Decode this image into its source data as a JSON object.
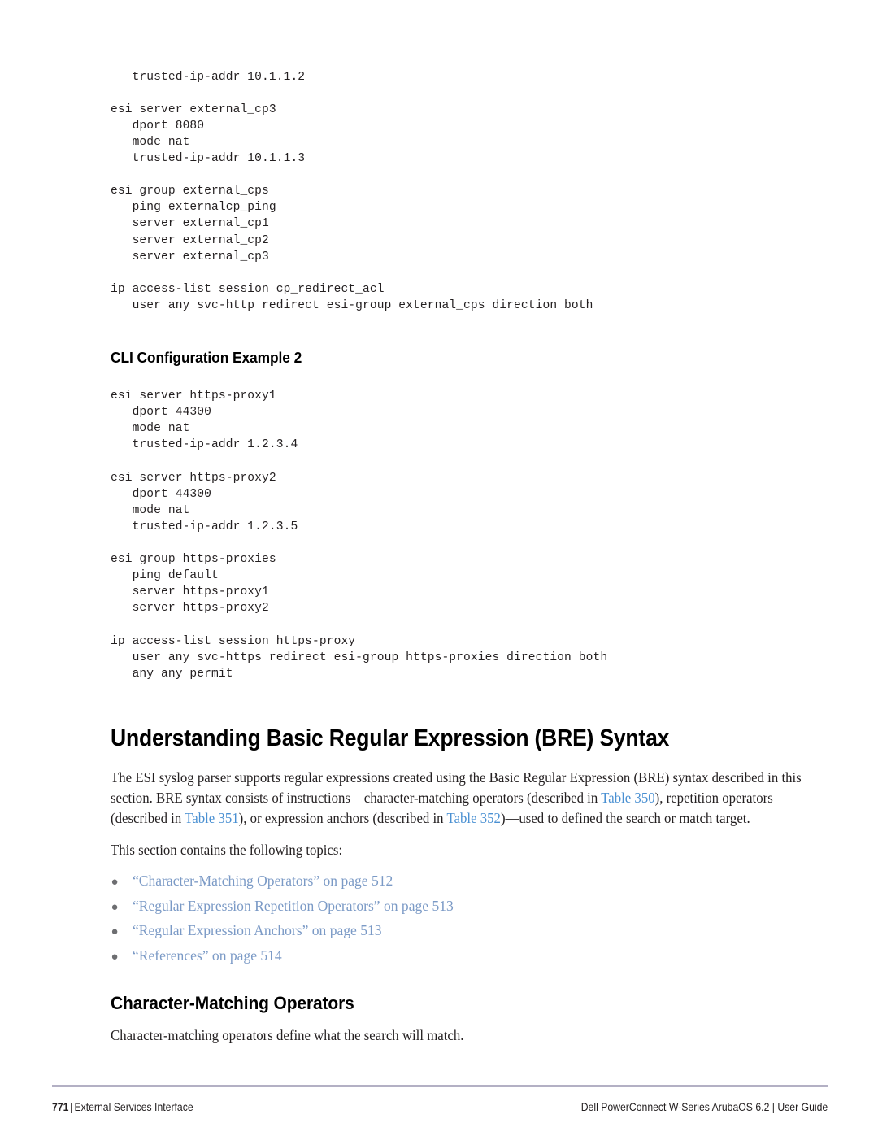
{
  "document": {
    "type": "user-guide-page",
    "page_number": "771",
    "chapter": "External Services Interface",
    "product": "Dell PowerConnect W-Series ArubaOS 6.2 | User Guide"
  },
  "code_block_1": {
    "lines": [
      "   trusted-ip-addr 10.1.1.2",
      "",
      "esi server external_cp3",
      "   dport 8080",
      "   mode nat",
      "   trusted-ip-addr 10.1.1.3",
      "",
      "esi group external_cps",
      "   ping externalcp_ping",
      "   server external_cp1",
      "   server external_cp2",
      "   server external_cp3",
      "",
      "ip access-list session cp_redirect_acl",
      "   user any svc-http redirect esi-group external_cps direction both"
    ]
  },
  "heading_cli_example_2": "CLI Configuration Example 2",
  "code_block_2": {
    "lines": [
      "esi server https-proxy1",
      "   dport 44300",
      "   mode nat",
      "   trusted-ip-addr 1.2.3.4",
      "",
      "esi server https-proxy2",
      "   dport 44300",
      "   mode nat",
      "   trusted-ip-addr 1.2.3.5",
      "",
      "esi group https-proxies",
      "   ping default",
      "   server https-proxy1",
      "   server https-proxy2",
      "",
      "ip access-list session https-proxy",
      "   user any svc-https redirect esi-group https-proxies direction both",
      "   any any permit"
    ]
  },
  "section_bre": {
    "heading": "Understanding Basic Regular Expression (BRE) Syntax",
    "paragraph_parts": {
      "p1": "The ESI syslog parser supports regular expressions created using the Basic Regular Expression (BRE) syntax described in this section. BRE syntax consists of instructions—character-matching operators (described in ",
      "link1": "Table 350",
      "p2": "), repetition operators (described in ",
      "link2": "Table 351",
      "p3": "), or expression anchors (described in ",
      "link3": "Table 352",
      "p4": ")—used to defined the search or match target."
    },
    "topics_intro": "This section contains the following topics:",
    "topics": [
      {
        "bullet": "●",
        "label": "“Character-Matching Operators” on page 512"
      },
      {
        "bullet": "●",
        "label": "“Regular Expression Repetition Operators” on page 513"
      },
      {
        "bullet": "●",
        "label": "“Regular Expression Anchors” on page 513"
      },
      {
        "bullet": "●",
        "label": "“References” on page 514"
      }
    ]
  },
  "section_char_matching": {
    "heading": "Character-Matching Operators",
    "paragraph": "Character-matching operators define what the search will match."
  },
  "footer": {
    "page_number": "771",
    "separator": "|",
    "chapter": "External Services Interface",
    "right": "Dell PowerConnect W-Series ArubaOS 6.2 | User Guide"
  },
  "colors": {
    "xref_link": "#4a90d2",
    "topic_link": "#7b9ac6",
    "bullet": "#6d6e71",
    "text": "#231f20",
    "footer_rule": "#b3b0c4"
  }
}
